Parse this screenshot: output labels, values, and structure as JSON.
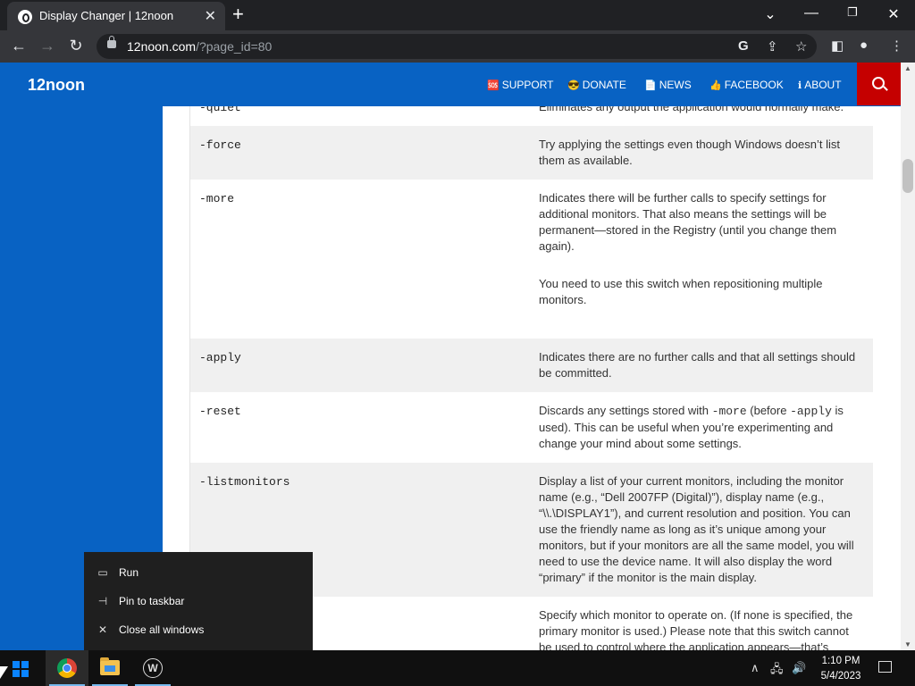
{
  "browser": {
    "tab_title": "Display Changer | 12noon",
    "url_domain": "12noon.com",
    "url_rest": "/?page_id=80"
  },
  "site": {
    "logo": "12noon",
    "nav": [
      {
        "icon": "🆘",
        "label": "SUPPORT"
      },
      {
        "icon": "😎",
        "label": "DONATE"
      },
      {
        "icon": "📄",
        "label": "NEWS"
      },
      {
        "icon": "👍",
        "label": "FACEBOOK"
      },
      {
        "icon": "ℹ",
        "label": "ABOUT"
      }
    ]
  },
  "options": [
    {
      "option": "-quiet",
      "desc": [
        "Eliminates any output the application would normally make."
      ]
    },
    {
      "option": "-force",
      "desc": [
        "Try applying the settings even though Windows doesn’t list them as available."
      ]
    },
    {
      "option": "-more",
      "desc": [
        "Indicates there will be further calls to specify settings for additional monitors. That also means the settings will be permanent—stored in the Registry (until you change them again).",
        "You need to use this switch when repositioning multiple monitors."
      ]
    },
    {
      "option": "-apply",
      "desc": [
        "Indicates there are no further calls and that all settings should be committed."
      ]
    },
    {
      "option": "-reset",
      "desc_parts": [
        "Discards any settings stored with ",
        "-more",
        " (before ",
        "-apply",
        " is used). This can be useful when you’re experimenting and change your mind about some settings."
      ]
    },
    {
      "option": "-listmonitors",
      "desc": [
        "Display a list of your current monitors, including the monitor name (e.g., “Dell 2007FP (Digital)”), display name (e.g., “\\\\.\\DISPLAY1”), and current resolution and position. You can use the friendly name as long as it’s unique among your monitors, but if your monitors are all the same model, you will need to use the device name. It will also display the word “primary” if the monitor is the main display."
      ]
    },
    {
      "option": "",
      "desc": [
        "Specify which monitor to operate on. (If none is specified, the primary monitor is used.) Please note that this switch cannot be used to control where the application appears—that’s something only the application can decide. (See below"
      ]
    }
  ],
  "jumplist": [
    {
      "icon": "run-icon",
      "label": "Run"
    },
    {
      "icon": "pin-icon",
      "label": "Pin to taskbar"
    },
    {
      "icon": "close-icon",
      "label": "Close all windows"
    }
  ],
  "taskbar": {
    "time": "1:10 PM",
    "date": "5/4/2023"
  }
}
